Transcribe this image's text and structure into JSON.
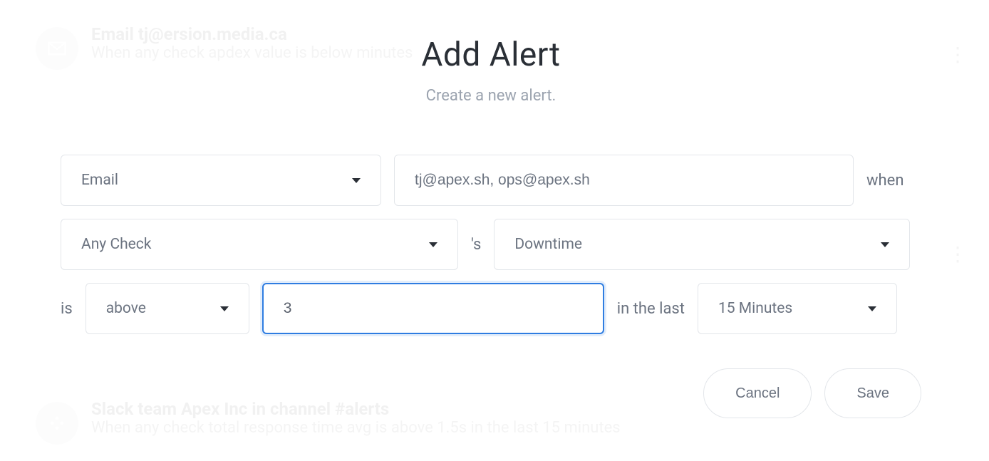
{
  "modal": {
    "title": "Add Alert",
    "subtitle": "Create a new alert."
  },
  "form": {
    "channel": "Email",
    "recipients": "tj@apex.sh, ops@apex.sh",
    "when_label": "when",
    "check": "Any Check",
    "possessive_label": "'s",
    "metric": "Downtime",
    "is_label": "is",
    "comparator": "above",
    "value": "3",
    "in_last_label": "in the last",
    "timeframe": "15 Minutes"
  },
  "actions": {
    "cancel": "Cancel",
    "save": "Save"
  },
  "background": {
    "top_title": "Email tj@ersion.media.ca",
    "top_sub": "When any check apdex value is below                          minutes",
    "bottom_title": "Slack team Apex Inc in channel #alerts",
    "bottom_sub": "When any check total response time avg is above 1.5s in the last 15 minutes"
  }
}
